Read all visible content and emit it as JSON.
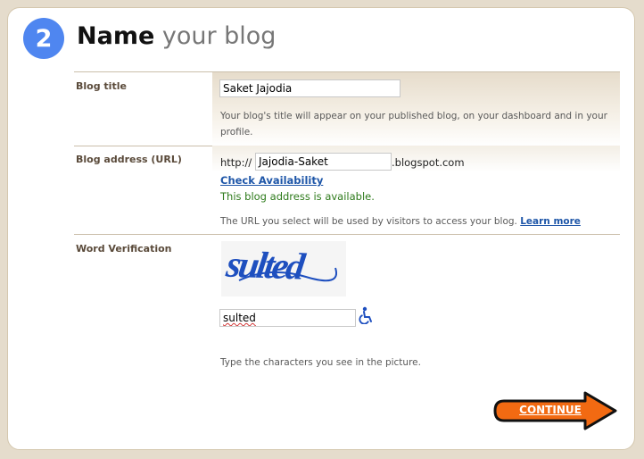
{
  "step": {
    "number": "2",
    "title_bold": "Name",
    "title_rest": " your blog"
  },
  "blog_title": {
    "label": "Blog title",
    "value": "Saket Jajodia",
    "help_line1": "Your blog's title will appear on your published blog, on your dashboard and in your",
    "help_line2": "profile."
  },
  "blog_address": {
    "label": "Blog address (URL)",
    "prefix": "http://",
    "value": "Jajodia-Saket",
    "suffix": ".blogspot.com",
    "check_link": "Check Availability",
    "status": "This blog address is available.",
    "help": "The URL you select will be used by visitors to access your blog.",
    "learn_more": "Learn more"
  },
  "word_verification": {
    "label": "Word Verification",
    "captcha_word": "sulted",
    "input_value": "sulted",
    "help": "Type the characters you see in the picture.",
    "accessibility_icon": "wheelchair-icon"
  },
  "continue_button": {
    "label": "CONTINUE",
    "color": "#f26a12"
  },
  "colors": {
    "step_circle": "#4f86f0",
    "link": "#1e56a8",
    "ok": "#2d7a1a"
  }
}
